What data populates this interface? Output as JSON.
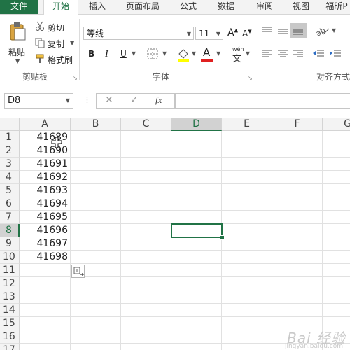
{
  "tabs": [
    "文件",
    "开始",
    "插入",
    "页面布局",
    "公式",
    "数据",
    "审阅",
    "视图",
    "福昕P"
  ],
  "clipboard": {
    "paste": "粘贴",
    "cut": "剪切",
    "copy": "复制",
    "format_painter": "格式刷",
    "group_label": "剪贴板"
  },
  "font": {
    "name": "等线",
    "size": "11",
    "group_label": "字体",
    "bold": "B",
    "italic": "I",
    "underline": "U",
    "grow": "A",
    "shrink": "A",
    "font_color": "A",
    "phonetic_top": "wén",
    "phonetic_bottom": "文"
  },
  "alignment": {
    "group_label": "对齐方式"
  },
  "formula_bar": {
    "name_box": "D8",
    "cancel": "✕",
    "enter": "✓",
    "fx": "fx",
    "formula": ""
  },
  "columns": [
    "A",
    "B",
    "C",
    "D",
    "E",
    "F",
    "G"
  ],
  "rows": [
    "1",
    "2",
    "3",
    "4",
    "5",
    "6",
    "7",
    "8",
    "9",
    "10",
    "11",
    "12",
    "13",
    "14",
    "15",
    "16",
    "17"
  ],
  "cells_A": [
    "41689",
    "41690",
    "41691",
    "41692",
    "41693",
    "41694",
    "41695",
    "41696",
    "41697",
    "41698"
  ],
  "selected_cell": "D8",
  "watermark": {
    "main": "Bai 经验",
    "sub": "jingyan.baidu.com"
  },
  "colors": {
    "accent": "#217346",
    "header_bg": "#f3f3f3",
    "gridline": "#e1e1e1"
  }
}
